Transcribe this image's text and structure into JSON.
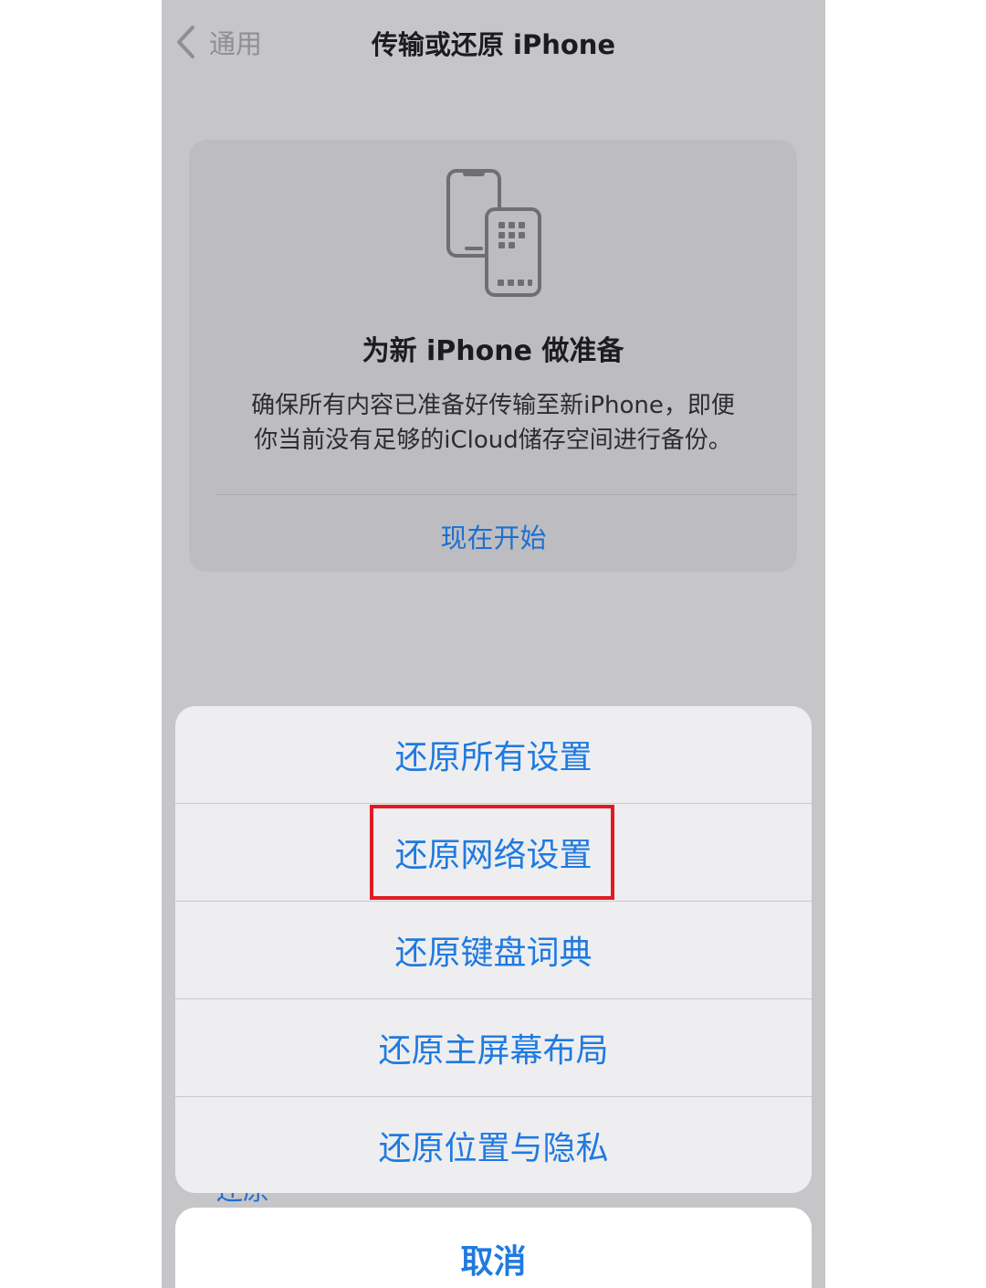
{
  "nav": {
    "back_label": "通用",
    "title": "传输或还原 iPhone"
  },
  "card": {
    "icon": "phone-transfer-icon",
    "title": "为新 iPhone 做准备",
    "description_line1": "确保所有内容已准备好传输至新iPhone，即便",
    "description_line2": "你当前没有足够的iCloud储存空间进行备份。",
    "action_label": "现在开始"
  },
  "behind_text": "还原",
  "action_sheet": {
    "items": [
      {
        "label": "还原所有设置"
      },
      {
        "label": "还原网络设置"
      },
      {
        "label": "还原键盘词典"
      },
      {
        "label": "还原主屏幕布局"
      },
      {
        "label": "还原位置与隐私"
      }
    ],
    "highlighted_item": "还原网络设置",
    "cancel_label": "取消"
  },
  "colors": {
    "accent": "#1f7ae0",
    "highlight": "#e01b24",
    "dim_background": "#c6c6c9"
  }
}
